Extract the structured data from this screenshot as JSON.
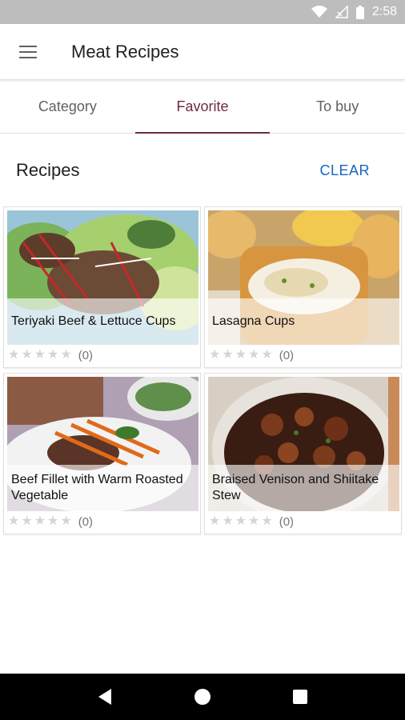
{
  "status_bar": {
    "time": "2:58",
    "icons": [
      "wifi-icon",
      "signal-icon",
      "battery-icon"
    ]
  },
  "app_bar": {
    "title": "Meat Recipes",
    "menu_icon": "menu-icon"
  },
  "tabs": [
    {
      "label": "Category",
      "active": false
    },
    {
      "label": "Favorite",
      "active": true
    },
    {
      "label": "To buy",
      "active": false
    }
  ],
  "section": {
    "title": "Recipes",
    "clear_label": "CLEAR"
  },
  "recipes": [
    {
      "name": "Teriyaki Beef & Lettuce Cups",
      "rating": 0,
      "count": "(0)"
    },
    {
      "name": "Lasagna Cups",
      "rating": 0,
      "count": "(0)"
    },
    {
      "name": "Beef Fillet with Warm Roasted Vegetable",
      "rating": 0,
      "count": "(0)"
    },
    {
      "name": "Braised Venison and Shiitake Stew",
      "rating": 0,
      "count": "(0)"
    }
  ],
  "nav_bar": {
    "icons": [
      "back-icon",
      "home-icon",
      "recents-icon"
    ]
  },
  "colors": {
    "accent": "#6d2b42",
    "link": "#1565c0",
    "status_bar": "#bdbdbd"
  }
}
